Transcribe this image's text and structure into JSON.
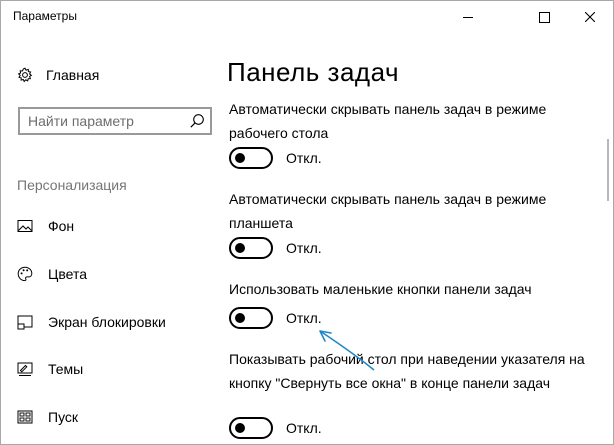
{
  "window": {
    "title": "Параметры"
  },
  "sidebar": {
    "home_label": "Главная",
    "search": {
      "placeholder": "Найти параметр",
      "value": ""
    },
    "section_label": "Персонализация",
    "items": [
      {
        "label": "Фон",
        "icon": "picture-icon"
      },
      {
        "label": "Цвета",
        "icon": "palette-icon"
      },
      {
        "label": "Экран блокировки",
        "icon": "lock-screen-icon"
      },
      {
        "label": "Темы",
        "icon": "themes-icon"
      },
      {
        "label": "Пуск",
        "icon": "start-icon"
      }
    ]
  },
  "main": {
    "title": "Панель задач",
    "settings": [
      {
        "label": "Автоматически скрывать панель задач в режиме рабочего стола",
        "state": "Откл.",
        "on": false
      },
      {
        "label": "Автоматически скрывать панель задач в режиме планшета",
        "state": "Откл.",
        "on": false
      },
      {
        "label": "Использовать маленькие кнопки панели задач",
        "state": "Откл.",
        "on": false
      },
      {
        "label": "Показывать рабочий стол при наведении указателя на кнопку \"Свернуть все окна\" в конце панели задач",
        "state": "Откл.",
        "on": false
      }
    ]
  },
  "colors": {
    "annotation_arrow": "#1e88c8",
    "toggle_off": "#000000",
    "secondary_text": "#767676"
  }
}
